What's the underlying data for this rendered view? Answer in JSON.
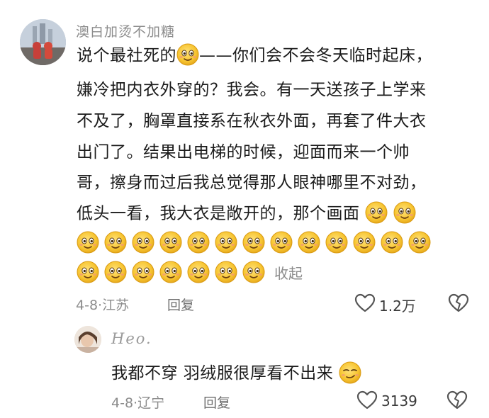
{
  "comment": {
    "username": "澳白加烫不加糖",
    "lines": [
      "说个最社死的",
      "——你们会不会冬天临时起床，",
      "嫌冷把内衣外穿的？我会。有一天送孩子上学来",
      "不及了，胸罩直接系在秋衣外面，再套了件大衣",
      "出门了。结果出电梯的时候，迎面而来一个帅",
      "哥，擦身而过后我总觉得那人眼神哪里不对劲，",
      "低头一看，我大衣是敞开的，那个画面"
    ],
    "collapse_label": "收起",
    "date": "4-8·江苏",
    "reply_label": "回复",
    "likes": "1.2万"
  },
  "reply": {
    "username": "Heo.",
    "text": "我都不穿 羽绒服很厚看不出来",
    "date": "4-8·辽宁",
    "reply_label": "回复",
    "likes": "3139"
  },
  "colors": {
    "text": "#1b1b1b",
    "muted": "#8c8c8c",
    "emoji_face": "#f7c531"
  },
  "icons": {
    "emoji": "smiling-face-emoji",
    "like": "heart-outline-icon",
    "dislike": "broken-heart-icon"
  }
}
